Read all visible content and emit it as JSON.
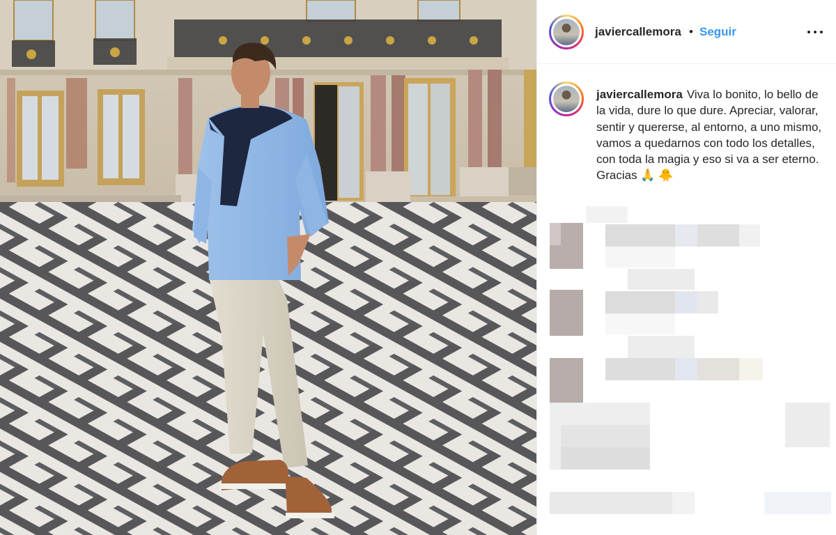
{
  "post": {
    "username": "javiercallemora",
    "separator": "•",
    "follow_label": "Seguir",
    "more_icon": "more-horizontal-icon",
    "caption_username": "javiercallemora",
    "caption_text": "Viva lo bonito, lo bello de la vida, dure lo que dure. Apreciar, valorar, sentir y quererse, al entorno, a uno mismo, vamos a quedarnos con todo los detalles, con toda la magia y eso si va a ser eterno. Gracias 🙏 🐥"
  },
  "colors": {
    "accent": "#3897f0",
    "text": "#262626",
    "border": "#efefef"
  }
}
